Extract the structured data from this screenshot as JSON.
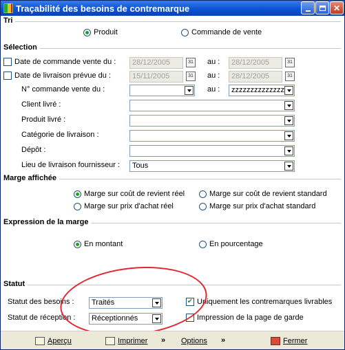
{
  "window": {
    "title": "Traçabilité des besoins de contremarque",
    "icon": "app-icon"
  },
  "tri": {
    "heading": "Tri",
    "options": [
      "Produit",
      "Commande de vente"
    ],
    "selected": "Produit"
  },
  "selection": {
    "heading": "Sélection",
    "date_commande": {
      "label": "Date de commande vente du :",
      "from": "28/12/2005",
      "to_label": "au :",
      "to": "28/12/2005",
      "checked": false
    },
    "date_livraison": {
      "label": "Date de livraison prévue du :",
      "from": "15/11/2005",
      "to_label": "au :",
      "to": "28/12/2005",
      "checked": false
    },
    "num_commande": {
      "label": "N° commande vente du :",
      "from": "",
      "to_label": "au :",
      "to": "zzzzzzzzzzzzzz"
    },
    "client": {
      "label": "Client livré :",
      "value": ""
    },
    "produit": {
      "label": "Produit livré :",
      "value": ""
    },
    "categorie": {
      "label": "Catégorie de livraison :",
      "value": ""
    },
    "depot": {
      "label": "Dépôt :",
      "value": ""
    },
    "lieu": {
      "label": "Lieu de livraison fournisseur :",
      "value": "Tous"
    }
  },
  "marge": {
    "heading": "Marge affichée",
    "options": [
      "Marge sur coût de revient réel",
      "Marge sur coût de revient standard",
      "Marge sur prix d'achat réel",
      "Marge sur prix d'achat standard"
    ],
    "selected": "Marge sur coût de revient réel"
  },
  "expression": {
    "heading": "Expression de la marge",
    "options": [
      "En montant",
      "En pourcentage"
    ],
    "selected": "En montant"
  },
  "statut": {
    "heading": "Statut",
    "besoins_label": "Statut des besoins :",
    "besoins_value": "Traités",
    "reception_label": "Statut de réception :",
    "reception_value": "Réceptionnés",
    "livrables_label": "Uniquement les contremarques livrables",
    "livrables_checked": true,
    "garde_label": "Impression de la page de garde",
    "garde_checked": false
  },
  "buttons": {
    "apercu": "Aperçu",
    "imprimer": "Imprimer",
    "options": "Options",
    "fermer": "Fermer"
  },
  "colors": {
    "titlebar": "#0a52d8",
    "annotation": "#e0262c",
    "check": "#21a121"
  }
}
